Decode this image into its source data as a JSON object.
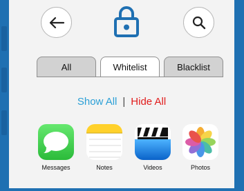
{
  "header": {
    "back_icon": "arrow-left-icon",
    "title_icon": "lock-icon",
    "search_icon": "search-icon",
    "accent_color": "#1f70b2"
  },
  "tabs": [
    {
      "label": "All",
      "active": false
    },
    {
      "label": "Whitelist",
      "active": true
    },
    {
      "label": "Blacklist",
      "active": false
    }
  ],
  "filter": {
    "show_all": "Show All",
    "separator": "|",
    "hide_all": "Hide All",
    "show_color": "#2a9fd6",
    "hide_color": "#e11b1b"
  },
  "apps": [
    {
      "label": "Messages",
      "icon": "messages-icon"
    },
    {
      "label": "Notes",
      "icon": "notes-icon"
    },
    {
      "label": "Videos",
      "icon": "videos-icon"
    },
    {
      "label": "Photos",
      "icon": "photos-icon"
    }
  ]
}
